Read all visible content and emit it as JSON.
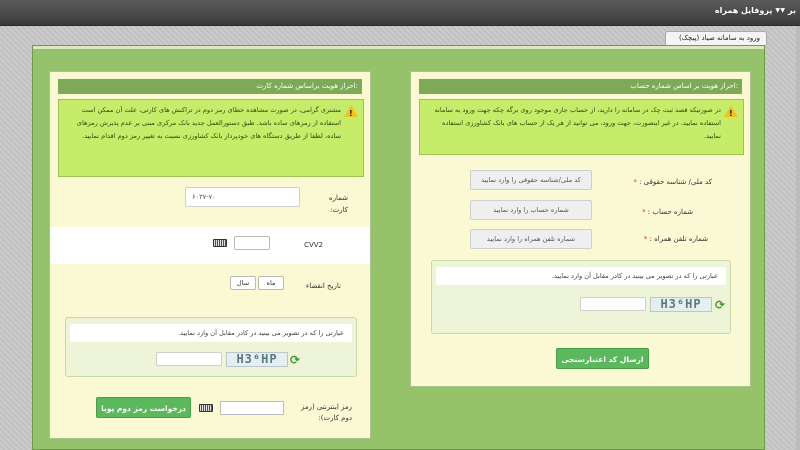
{
  "topbar": {
    "menu_profile": "پروفایل همراه",
    "menu_partial": "بر"
  },
  "page_tab": "ورود به سامانه صیاد (پیچک)",
  "account_card": {
    "title": "احراز هویت بر اساس شماره حساب:",
    "warning": "در صورتیکه قصد ثبت چک در سامانه را دارید، از حساب جاری موجود روی برگه چکه جهت ورود به سامانه استفاده نمایید. در غیر اینصورت، جهت ورود، می توانید از هر یک از حساب های بانک کشاورزی استفاده نمایید.",
    "national_id_label": "کد ملی/ شناسه حقوقی :",
    "national_id_placeholder": "کد ملی/شناسه حقوقی را وارد نمایید",
    "account_label": "شماره حساب :",
    "account_placeholder": "شماره حساب را وارد نمایید",
    "mobile_label": "شماره تلفن همراه :",
    "mobile_placeholder": "شماره تلفن همراه را وارد نمایید",
    "required_mark": "*",
    "captcha_instruction": "عبارتی را که در تصویر می بینید در کادر مقابل آن وارد نمایید.",
    "captcha_text": "H3⁶HP",
    "submit_label": "ارسال کد اعتبارسنجی"
  },
  "card_card": {
    "title": "احراز هویت براساس شماره کارت:",
    "warning": "مشتری گرامی، در صورت مشاهده خطای رمز دوم در تراکنش های کارتی، علت آن ممکن است استفاده از رمزهای ساده باشد. طبق دستورالعمل جدید بانک مرکزی مبنی بر عدم پذیرش رمزهای ساده، لطفا از طریق دستگاه های خودپرداز بانک کشاورزی نسبت به تغییر رمز دوم اقدام نمایید.",
    "card_number_label": "شماره کارت:",
    "card_number_value": "۶۰۳۷-۷۰",
    "cvv2_label": "CVV2",
    "expiry_label": "تاریخ انقضاء",
    "month_placeholder": "ماه",
    "year_placeholder": "سال",
    "captcha_instruction": "عبارتی را که در تصویر می بینید در کادر مقابل آن وارد نمایید.",
    "captcha_text": "H3⁶HP",
    "otp_label": "رمز اینترنتی (رمز دوم کارت):",
    "otp_button": "درخواست رمز دوم پویا"
  },
  "icons": {
    "warning": "warning-icon",
    "refresh": "refresh-icon",
    "keyboard": "keyboard-icon"
  },
  "colors": {
    "panel_green": "#97c26c",
    "card_bg": "#fbf8d4",
    "warning_bg": "#c6ec6a",
    "button_green": "#5cb85c"
  }
}
